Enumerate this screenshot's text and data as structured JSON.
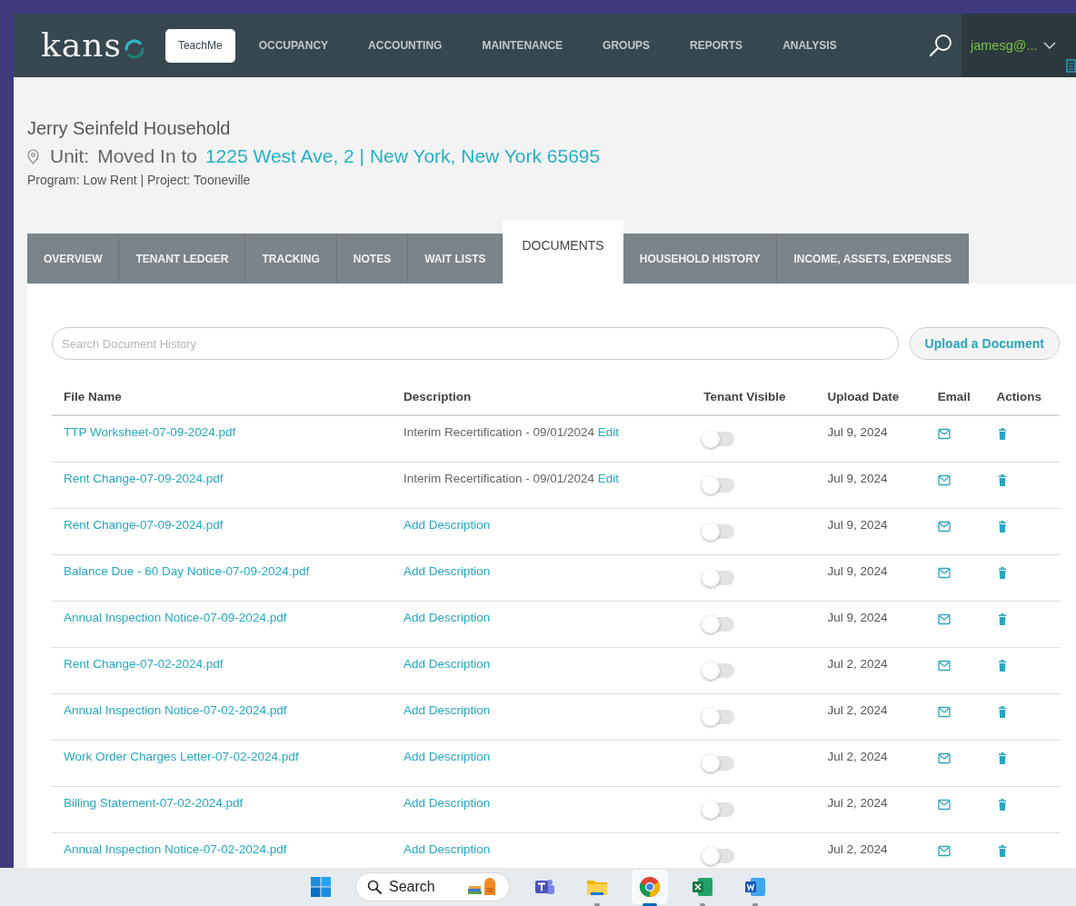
{
  "header": {
    "logo": "kans",
    "teach_me": "TeachMe",
    "nav": [
      "OCCUPANCY",
      "ACCOUNTING",
      "MAINTENANCE",
      "GROUPS",
      "REPORTS",
      "ANALYSIS"
    ],
    "user": "jamesg@..."
  },
  "household": {
    "title": "Jerry Seinfeld Household",
    "unit_label": "Unit:",
    "unit_status": "Moved In to",
    "address": "1225 West Ave, 2 | New York, New York 65695",
    "program": "Program: Low Rent | Project: Tooneville"
  },
  "tabs": [
    {
      "label": "OVERVIEW",
      "selected": false
    },
    {
      "label": "TENANT LEDGER",
      "selected": false
    },
    {
      "label": "TRACKING",
      "selected": false
    },
    {
      "label": "NOTES",
      "selected": false
    },
    {
      "label": "WAIT LISTS",
      "selected": false
    },
    {
      "label": "DOCUMENTS",
      "selected": true
    },
    {
      "label": "HOUSEHOLD HISTORY",
      "selected": false
    },
    {
      "label": "INCOME, ASSETS, EXPENSES",
      "selected": false
    }
  ],
  "search": {
    "placeholder": "Search Document History"
  },
  "upload_button": "Upload a Document",
  "table": {
    "columns": [
      "File Name",
      "Description",
      "Tenant Visible",
      "Upload Date",
      "Email",
      "Actions"
    ],
    "rows": [
      {
        "file_name": "TTP Worksheet-07-09-2024.pdf",
        "description": {
          "kind": "text",
          "text": "Interim Recertification - 09/01/2024",
          "edit": "Edit"
        },
        "tenant_visible": false,
        "upload_date": "Jul 9, 2024"
      },
      {
        "file_name": "Rent Change-07-09-2024.pdf",
        "description": {
          "kind": "text",
          "text": "Interim Recertification - 09/01/2024",
          "edit": "Edit"
        },
        "tenant_visible": false,
        "upload_date": "Jul 9, 2024"
      },
      {
        "file_name": "Rent Change-07-09-2024.pdf",
        "description": {
          "kind": "add",
          "text": "Add Description"
        },
        "tenant_visible": false,
        "upload_date": "Jul 9, 2024"
      },
      {
        "file_name": "Balance Due - 60 Day Notice-07-09-2024.pdf",
        "description": {
          "kind": "add",
          "text": "Add Description"
        },
        "tenant_visible": false,
        "upload_date": "Jul 9, 2024"
      },
      {
        "file_name": "Annual Inspection Notice-07-09-2024.pdf",
        "description": {
          "kind": "add",
          "text": "Add Description"
        },
        "tenant_visible": false,
        "upload_date": "Jul 9, 2024"
      },
      {
        "file_name": "Rent Change-07-02-2024.pdf",
        "description": {
          "kind": "add",
          "text": "Add Description"
        },
        "tenant_visible": false,
        "upload_date": "Jul 2, 2024"
      },
      {
        "file_name": "Annual Inspection Notice-07-02-2024.pdf",
        "description": {
          "kind": "add",
          "text": "Add Description"
        },
        "tenant_visible": false,
        "upload_date": "Jul 2, 2024"
      },
      {
        "file_name": "Work Order Charges Letter-07-02-2024.pdf",
        "description": {
          "kind": "add",
          "text": "Add Description"
        },
        "tenant_visible": false,
        "upload_date": "Jul 2, 2024"
      },
      {
        "file_name": "Billing Statement-07-02-2024.pdf",
        "description": {
          "kind": "add",
          "text": "Add Description"
        },
        "tenant_visible": false,
        "upload_date": "Jul 2, 2024"
      },
      {
        "file_name": "Annual Inspection Notice-07-02-2024.pdf",
        "description": {
          "kind": "add",
          "text": "Add Description"
        },
        "tenant_visible": false,
        "upload_date": "Jul 2, 2024"
      }
    ]
  },
  "taskbar": {
    "search_placeholder": "Search",
    "apps": [
      {
        "kind": "start",
        "running": false,
        "selected": false
      },
      {
        "kind": "teams",
        "running": false,
        "selected": false
      },
      {
        "kind": "explorer",
        "running": true,
        "selected": false
      },
      {
        "kind": "chrome",
        "running": true,
        "selected": true
      },
      {
        "kind": "excel",
        "running": true,
        "selected": false
      },
      {
        "kind": "word",
        "running": true,
        "selected": false
      }
    ]
  }
}
